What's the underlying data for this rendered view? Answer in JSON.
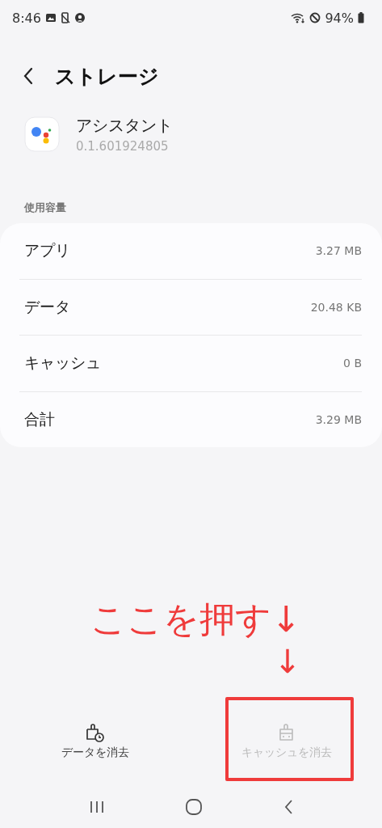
{
  "status_bar": {
    "time": "8:46",
    "battery": "94%"
  },
  "header": {
    "title": "ストレージ"
  },
  "app": {
    "name": "アシスタント",
    "version": "0.1.601924805"
  },
  "section": {
    "title": "使用容量"
  },
  "rows": [
    {
      "label": "アプリ",
      "value": "3.27 MB"
    },
    {
      "label": "データ",
      "value": "20.48 KB"
    },
    {
      "label": "キャッシュ",
      "value": "0 B"
    },
    {
      "label": "合計",
      "value": "3.29 MB"
    }
  ],
  "annotation": {
    "text": "ここを押す↓",
    "arrow": "↓"
  },
  "actions": [
    {
      "kind": "data",
      "label": "データを消去",
      "disabled": false,
      "highlighted": false
    },
    {
      "kind": "cache",
      "label": "キャッシュを消去",
      "disabled": true,
      "highlighted": true
    }
  ]
}
